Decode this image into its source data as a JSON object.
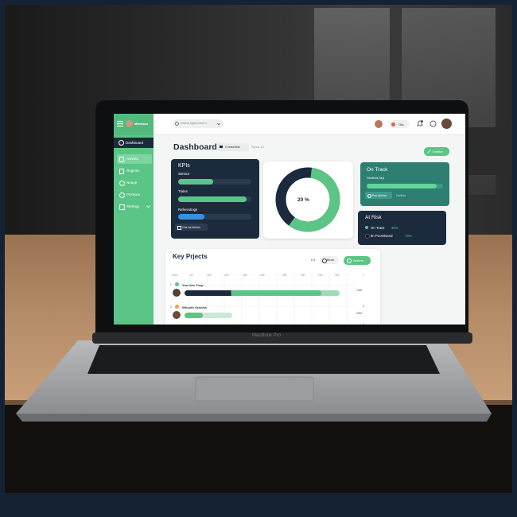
{
  "colors": {
    "frame": "#152234",
    "brand_green": "#5BC585",
    "navy_card": "#1C2A3D",
    "teal_card": "#2D7F72",
    "wall": "#1E1E1E",
    "desk": "#B08763",
    "laptop_body": "#A7A8AC",
    "keyboard": "#1B1C1F"
  },
  "icons": [
    "menu-icon",
    "avatar",
    "search-icon",
    "chevron-down-icon",
    "user-avatar",
    "chrome-icon",
    "bell-icon",
    "chat-icon",
    "profile-avatar",
    "dashboard-icon",
    "activity-icon",
    "region-icon",
    "heart-icon",
    "globe-icon",
    "gear-icon",
    "expand-icon",
    "edit-icon",
    "check-icon",
    "leaf-icon"
  ],
  "app": {
    "brand": "Mlentacs"
  },
  "search": {
    "placeholder": "Search tigths Inisot c..."
  },
  "header": {
    "status_label": "Ota"
  },
  "sidebar": {
    "items": [
      {
        "label": "Dashboard"
      },
      {
        "label": "Actvnts"
      },
      {
        "label": "Regines"
      },
      {
        "label": "Neage"
      },
      {
        "label": "Postions"
      },
      {
        "label": "Stetings"
      }
    ]
  },
  "page": {
    "title": "Dashboard",
    "chip_label": "Crontonlitas",
    "crumb": "Syncs  13",
    "action_button": "Dosticn"
  },
  "kpis": {
    "title": "KPIs",
    "rows": [
      {
        "label": "Stetncs",
        "progress": 0.48
      },
      {
        "label": "Trales",
        "progress": 0.93
      },
      {
        "label": "Referestiogs",
        "progress": 0.36
      }
    ],
    "footer_button": "One ea fotmes"
  },
  "donut": {
    "label": "20 %",
    "green_fraction": 0.58,
    "green_start_fraction": 0.02
  },
  "on_track": {
    "title": "On Track",
    "subtitle": "Sesthds hsp",
    "progress": 0.92,
    "button": "Pen Abhrse",
    "link": "Dedhas"
  },
  "at_risk": {
    "title": "At Risk",
    "items": [
      {
        "label": "On Track",
        "value": "30%"
      },
      {
        "label": "8n Poonitsand",
        "value": "73%"
      }
    ]
  },
  "projects": {
    "title": "Key Prjects",
    "filter_label": "Fol",
    "block_label": "Block",
    "button": "Sesters",
    "axis": [
      "1000",
      "50",
      "100",
      "190",
      "150",
      "100",
      "180",
      "180",
      "150",
      "150"
    ],
    "right_values": [
      "1000",
      "0",
      "2500",
      "0"
    ],
    "rows": [
      {
        "num": "1",
        "name": "You Can Tnep",
        "progress": 0.88
      },
      {
        "num": "2",
        "name": "Whouth Seeoiss",
        "progress": 0.38
      }
    ]
  },
  "laptop": {
    "brand_label": "MacBook Pro"
  }
}
